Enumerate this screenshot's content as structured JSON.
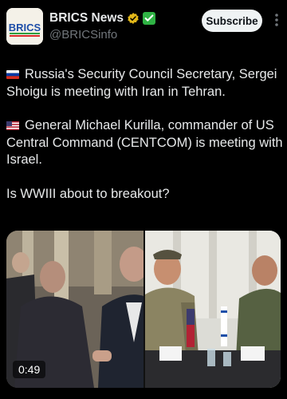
{
  "account": {
    "display_name": "BRICS News",
    "handle": "@BRICSinfo",
    "avatar_text": "BRICS"
  },
  "header": {
    "subscribe_label": "Subscribe"
  },
  "tweet": {
    "line1": "Russia's Security Council Secretary, Sergei Shoigu is meeting with Iran in Tehran.",
    "line2": "General Michael Kurilla, commander of US Central Command (CENTCOM) is meeting with Israel.",
    "line3": "Is WWIII about to breakout?"
  },
  "media": {
    "duration": "0:49"
  },
  "colors": {
    "background": "#000000",
    "text": "#e7e9ea",
    "secondary": "#71767b",
    "subscribe_bg": "#eff3f4",
    "verified_gold": "#e2b719",
    "affiliate_green": "#2fb344"
  }
}
